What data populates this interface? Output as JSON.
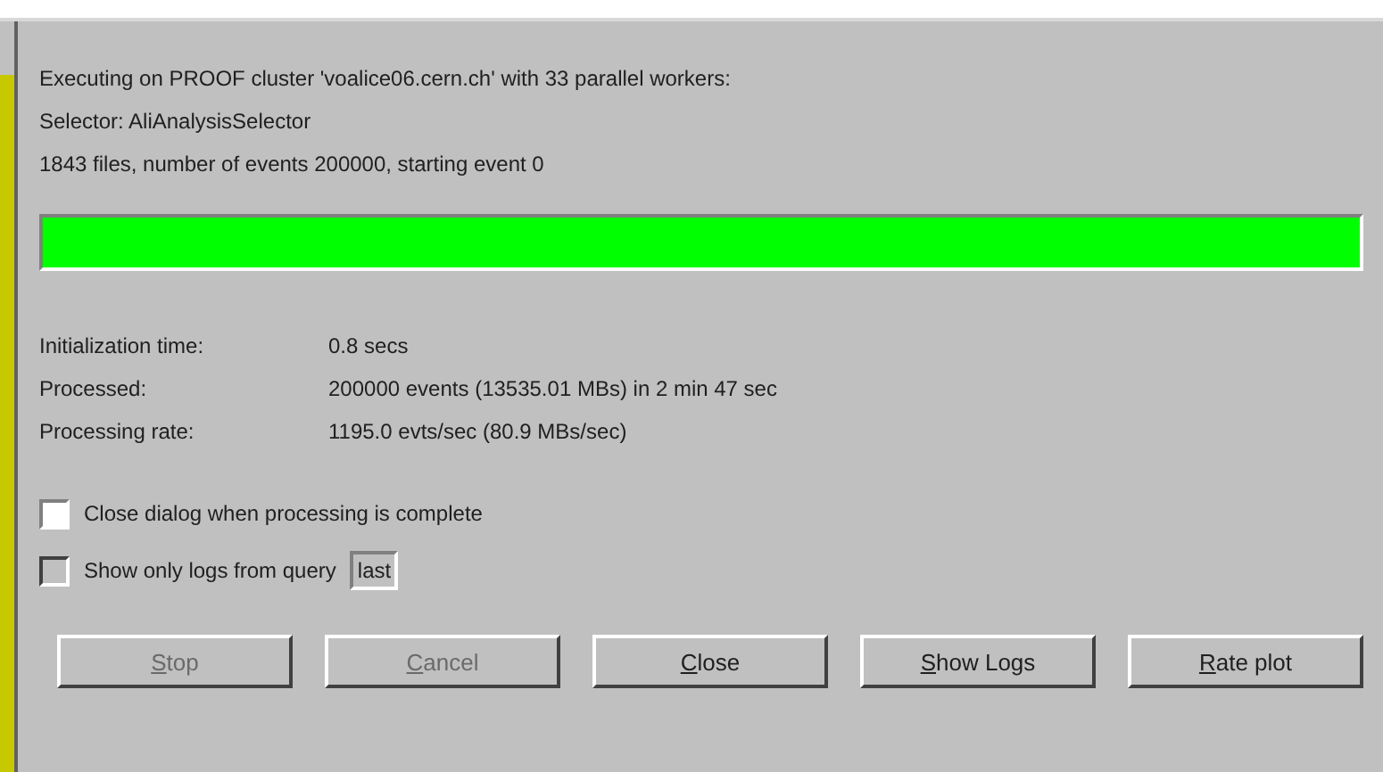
{
  "info_lines": [
    "Executing on PROOF cluster 'voalice06.cern.ch' with 33 parallel workers:",
    "Selector: AliAnalysisSelector",
    "1843 files, number of events 200000, starting event 0"
  ],
  "progress": {
    "level": 1
  },
  "stats": [
    {
      "label": "Initialization time:",
      "value": "0.8 secs"
    },
    {
      "label": "Processed:",
      "value": "200000 events (13535.01 MBs) in 2 min 47 sec"
    },
    {
      "label": "Processing rate:",
      "value": "1195.0 evts/sec (80.9 MBs/sec)"
    }
  ],
  "options": [
    {
      "label": "Close dialog when processing is complete",
      "checked": false,
      "disabled": false
    },
    {
      "label": "Show only logs from query",
      "checked": false,
      "disabled": true,
      "field_value": "last"
    }
  ],
  "buttons": [
    {
      "label": "Stop",
      "disabled": true,
      "underline_first": true
    },
    {
      "label": "Cancel",
      "disabled": true,
      "underline_first": true
    },
    {
      "label": "Close",
      "disabled": false,
      "underline_first": true
    },
    {
      "label": "Show Logs",
      "disabled": false,
      "underline_first": true
    },
    {
      "label": "Rate plot",
      "disabled": false,
      "underline_first": true
    }
  ]
}
